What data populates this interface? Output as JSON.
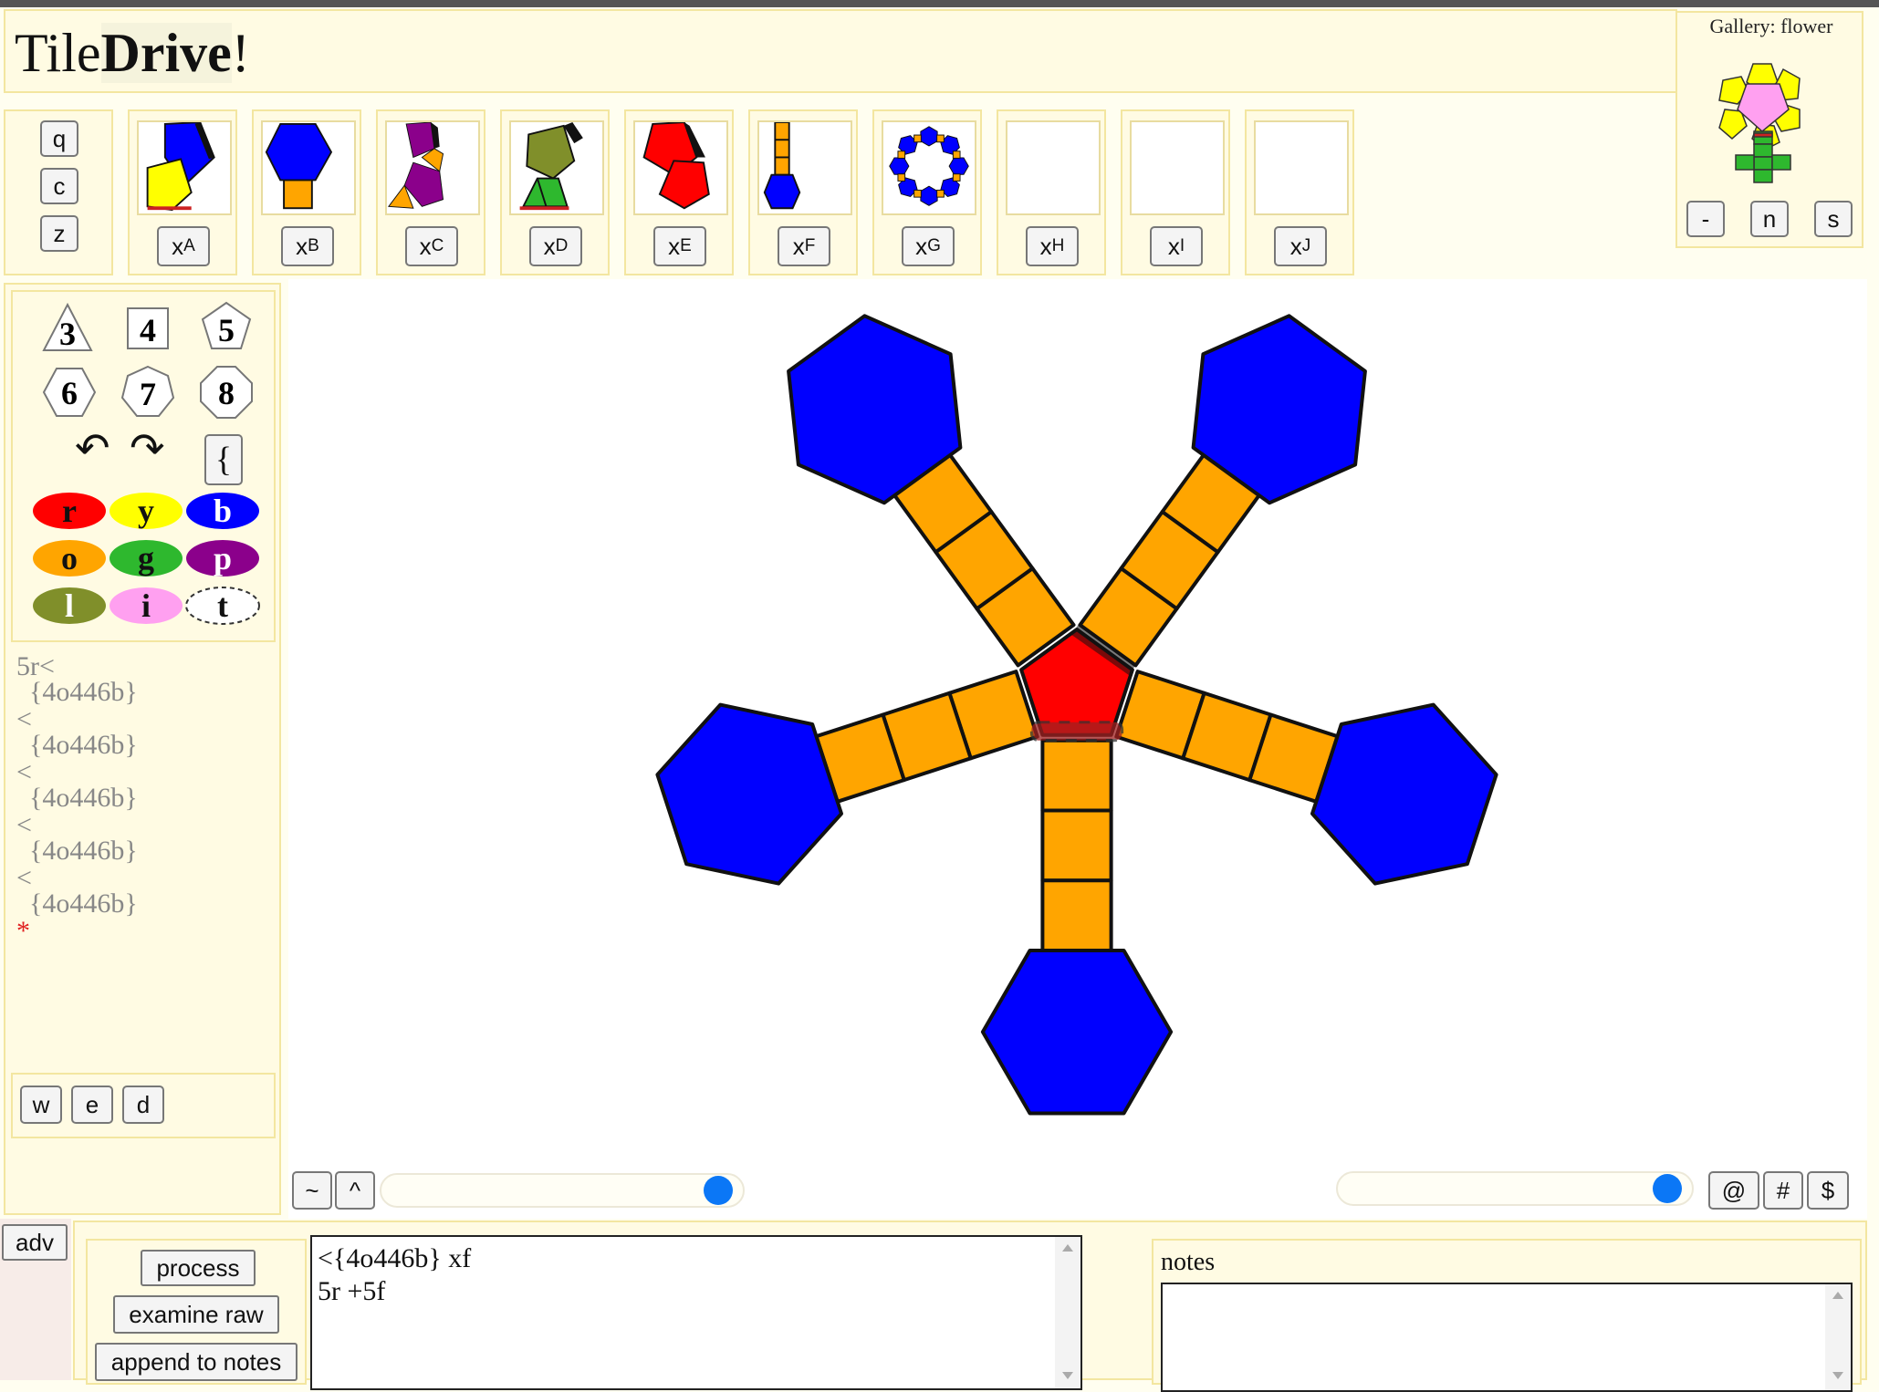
{
  "app": {
    "title_plain": "Tile",
    "title_bold": "Drive",
    "title_suffix": "!"
  },
  "toolbar_left": [
    "q",
    "c",
    "z"
  ],
  "slots": [
    {
      "label": "x",
      "sub": "A"
    },
    {
      "label": "x",
      "sub": "B"
    },
    {
      "label": "x",
      "sub": "C"
    },
    {
      "label": "x",
      "sub": "D"
    },
    {
      "label": "x",
      "sub": "E"
    },
    {
      "label": "x",
      "sub": "F"
    },
    {
      "label": "x",
      "sub": "G"
    },
    {
      "label": "x",
      "sub": "H"
    },
    {
      "label": "x",
      "sub": "I"
    },
    {
      "label": "x",
      "sub": "J"
    }
  ],
  "gallery": {
    "label": "Gallery: flower",
    "buttons": [
      "-",
      "n",
      "s"
    ]
  },
  "shapes": [
    "3",
    "4",
    "5",
    "6",
    "7",
    "8"
  ],
  "rotate": {
    "left": "↶",
    "right": "↷",
    "brace": "{"
  },
  "colors": [
    {
      "key": "r",
      "color": "#ff0000"
    },
    {
      "key": "y",
      "color": "#ffff00"
    },
    {
      "key": "b",
      "color": "#0000ff"
    },
    {
      "key": "o",
      "color": "#ffa500"
    },
    {
      "key": "g",
      "color": "#2eb82e"
    },
    {
      "key": "p",
      "color": "#8b008b"
    },
    {
      "key": "l",
      "color": "#808f2a"
    },
    {
      "key": "i",
      "color": "#ffa0f0"
    },
    {
      "key": "t",
      "color": "transparent"
    }
  ],
  "code_lines": [
    "5r<",
    "{4o446b}",
    "<",
    "{4o446b}",
    "<",
    "{4o446b}",
    "<",
    "{4o446b}",
    "<",
    "{4o446b}",
    "*"
  ],
  "edit_buttons": [
    "w",
    "e",
    "d"
  ],
  "canvas_controls": {
    "tilde": "~",
    "caret": "^",
    "at": "@",
    "hash": "#",
    "dollar": "$",
    "slider_left": 0.98,
    "slider_right": 0.98
  },
  "bottom": {
    "adv": "adv",
    "process": "process",
    "examine_raw": "examine raw",
    "append_to_notes": "append to notes",
    "code_text": "<{4o446b} xf\n5r +5f",
    "notes_label": "notes",
    "notes_text": ""
  },
  "palette": {
    "blue": "#0000ff",
    "orange": "#ffa500",
    "red": "#ff0000",
    "yellow": "#ffff00",
    "green": "#2eb82e",
    "pink": "#ffa0f0",
    "purple": "#8b008b",
    "olive": "#808f2a"
  }
}
